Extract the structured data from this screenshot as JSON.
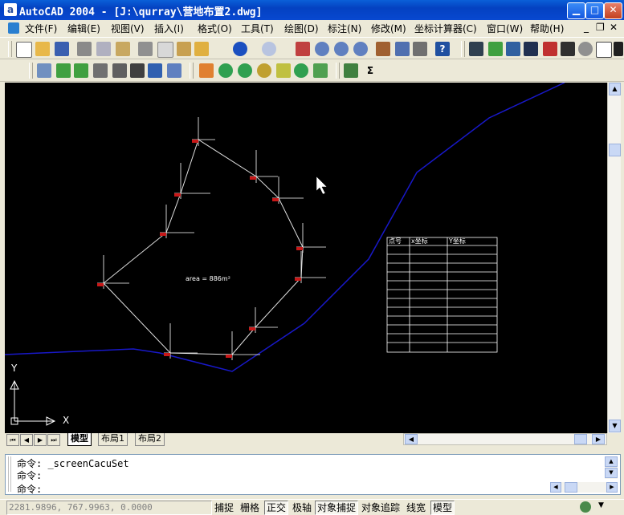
{
  "window": {
    "title": "AutoCAD 2004 - [J:\\qurray\\营地布置2.dwg]",
    "app_icon": "a",
    "colors": {
      "titlebar": "#0848d0",
      "canvas": "#000000",
      "polyline": "#1818c8"
    }
  },
  "menu": {
    "items": [
      "文件(F)",
      "编辑(E)",
      "视图(V)",
      "插入(I)",
      "格式(O)",
      "工具(T)",
      "绘图(D)",
      "标注(N)",
      "修改(M)",
      "坐标计算器(C)",
      "窗口(W)",
      "帮助(H)"
    ],
    "doc_controls": [
      "_",
      "❐",
      "✕"
    ]
  },
  "drawing": {
    "area_label": "area = 886m²",
    "table_headers": [
      "点号",
      "x坐标",
      "Y坐标"
    ],
    "table_rows": 11,
    "axis_y": "Y",
    "axis_x": "X"
  },
  "tabs": {
    "items": [
      "模型",
      "布局1",
      "布局2"
    ],
    "active": "模型"
  },
  "command": {
    "prompt1": "命令: ",
    "cmd1": "_screenCacuSet",
    "prompt2": "命令:",
    "prompt3": "命令:"
  },
  "status": {
    "coords": "2281.9896,  767.9963, 0.0000",
    "buttons": [
      {
        "label": "捕捉",
        "on": false
      },
      {
        "label": "栅格",
        "on": false
      },
      {
        "label": "正交",
        "on": true
      },
      {
        "label": "极轴",
        "on": false
      },
      {
        "label": "对象捕捉",
        "on": true
      },
      {
        "label": "对象追踪",
        "on": false
      },
      {
        "label": "线宽",
        "on": false
      },
      {
        "label": "模型",
        "on": true
      }
    ]
  }
}
